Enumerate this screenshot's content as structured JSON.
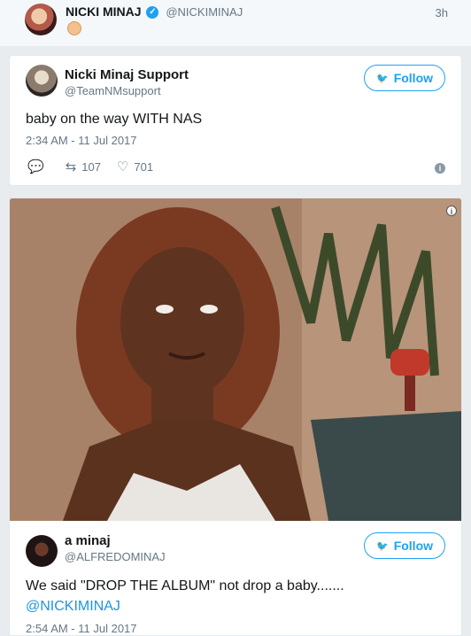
{
  "top_tweet": {
    "name": "NICKI MINAJ",
    "handle": "@NICKIMINAJ",
    "time": "3h"
  },
  "tweet1": {
    "name": "Nicki Minaj Support",
    "handle": "@TeamNMsupport",
    "follow_label": "Follow",
    "text": "baby on the way WITH NAS",
    "timestamp": "2:34 AM - 11 Jul 2017",
    "retweets": "107",
    "likes": "701"
  },
  "tweet2": {
    "name": "a minaj",
    "handle": "@ALFREDOMINAJ",
    "follow_label": "Follow",
    "text_line1": "We said \"DROP THE ALBUM\" not drop a baby.......",
    "mention": "@NICKIMINAJ",
    "timestamp": "2:54 AM - 11 Jul 2017"
  },
  "icons": {
    "verified": "check-icon",
    "reply": "reply-icon",
    "retweet": "retweet-icon",
    "like": "heart-icon",
    "info": "info-icon",
    "bird": "twitter-bird-icon"
  },
  "colors": {
    "accent": "#1da1f2",
    "secondary_text": "#657786"
  }
}
